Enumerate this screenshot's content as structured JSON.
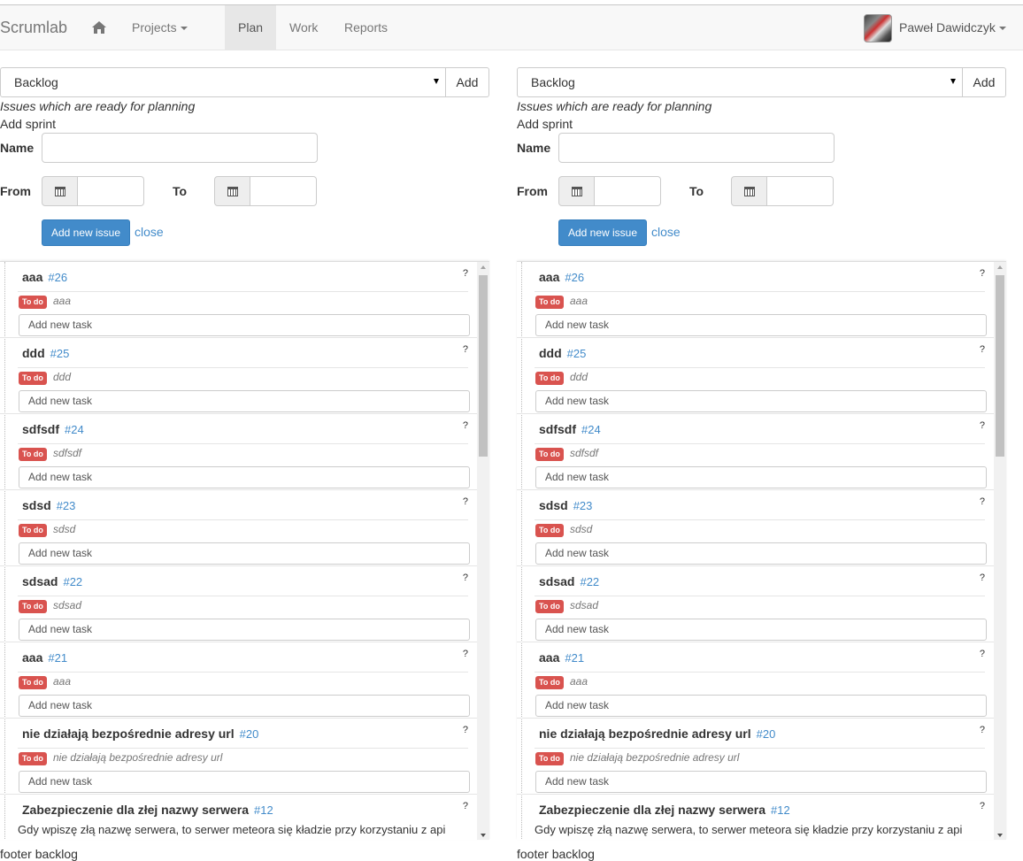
{
  "navbar": {
    "brand": "Scrumlab",
    "projects_label": "Projects",
    "tabs": [
      {
        "label": "Plan"
      },
      {
        "label": "Work"
      },
      {
        "label": "Reports"
      }
    ],
    "user_name": "Paweł Dawidczyk"
  },
  "columns": [
    {
      "select_value": "Backlog",
      "add_label": "Add",
      "description": "Issues which are ready for planning",
      "add_sprint": "Add sprint",
      "name_label": "Name",
      "from_label": "From",
      "to_label": "To",
      "add_issue_label": "Add new issue",
      "close_label": "close",
      "footer": "footer backlog"
    },
    {
      "select_value": "Backlog",
      "add_label": "Add",
      "description": "Issues which are ready for planning",
      "add_sprint": "Add sprint",
      "name_label": "Name",
      "from_label": "From",
      "to_label": "To",
      "add_issue_label": "Add new issue",
      "close_label": "close",
      "footer": "footer backlog"
    }
  ],
  "issues": [
    {
      "title": "aaa",
      "number": "#26",
      "status": "To do",
      "task": "aaa",
      "task_placeholder": "Add new task",
      "help": "?"
    },
    {
      "title": "ddd",
      "number": "#25",
      "status": "To do",
      "task": "ddd",
      "task_placeholder": "Add new task",
      "help": "?"
    },
    {
      "title": "sdfsdf",
      "number": "#24",
      "status": "To do",
      "task": "sdfsdf",
      "task_placeholder": "Add new task",
      "help": "?"
    },
    {
      "title": "sdsd",
      "number": "#23",
      "status": "To do",
      "task": "sdsd",
      "task_placeholder": "Add new task",
      "help": "?"
    },
    {
      "title": "sdsad",
      "number": "#22",
      "status": "To do",
      "task": "sdsad",
      "task_placeholder": "Add new task",
      "help": "?"
    },
    {
      "title": "aaa",
      "number": "#21",
      "status": "To do",
      "task": "aaa",
      "task_placeholder": "Add new task",
      "help": "?"
    },
    {
      "title": "nie działają bezpośrednie adresy url",
      "number": "#20",
      "status": "To do",
      "task": "nie działają bezpośrednie adresy url",
      "task_placeholder": "Add new task",
      "help": "?"
    },
    {
      "title": "Zabezpieczenie dla złej nazwy serwera",
      "number": "#12",
      "description": "Gdy wpiszę złą nazwę serwera, to serwer meteora się kładzie przy korzystaniu z api",
      "help": "?"
    }
  ]
}
